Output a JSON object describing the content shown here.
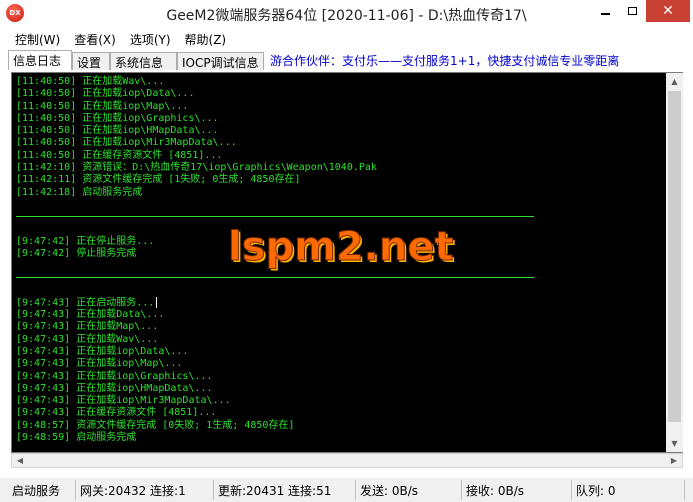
{
  "window": {
    "title": "GeeM2微端服务器64位 [2020-11-06] - D:\\热血传奇17\\",
    "icon_text": "DX"
  },
  "menu": [
    "控制(W)",
    "查看(X)",
    "选项(Y)",
    "帮助(Z)"
  ],
  "tabs": [
    "信息日志",
    "设置",
    "系统信息",
    "IOCP调试信息"
  ],
  "partner_text": "游合作伙伴：支付乐——支付服务1+1，快捷支付诚信专业零距离",
  "log_group1": [
    "[11:40:50] 正在加载Wav\\...",
    "[11:40:50] 正在加载iop\\Data\\...",
    "[11:40:50] 正在加载iop\\Map\\...",
    "[11:40:50] 正在加载iop\\Graphics\\...",
    "[11:40:50] 正在加载iop\\HMapData\\...",
    "[11:40:50] 正在加载iop\\Mir3MapData\\...",
    "[11:40:50] 正在缓存资源文件 [4851]...",
    "[11:42:10] 资源错误：D:\\热血传奇17\\iop\\Graphics\\Weapon\\1040.Pak",
    "[11:42:11] 资源文件缓存完成 [1失败; 0生成; 4850存在]",
    "[11:42:18] 启动服务完成"
  ],
  "log_group2": [
    "[9:47:42] 正在停止服务...",
    "[9:47:42] 停止服务完成"
  ],
  "log_group3": [
    "[9:47:43] 正在启动服务...",
    "[9:47:43] 正在加载Data\\...",
    "[9:47:43] 正在加载Map\\...",
    "[9:47:43] 正在加载Wav\\...",
    "[9:47:43] 正在加载iop\\Data\\...",
    "[9:47:43] 正在加载iop\\Map\\...",
    "[9:47:43] 正在加载iop\\Graphics\\...",
    "[9:47:43] 正在加载iop\\HMapData\\...",
    "[9:47:43] 正在加载iop\\Mir3MapData\\...",
    "[9:47:43] 正在缓存资源文件 [4851]...",
    "[9:48:57] 资源文件缓存完成 [0失败; 1生成; 4850存在]",
    "[9:48:59] 启动服务完成"
  ],
  "watermark": "lspm2.net",
  "status": {
    "service": "启动服务",
    "gateway": "网关:20432  连接:1",
    "update": "更新:20431  连接:51",
    "send": "发送: 0B/s",
    "recv": "接收: 0B/s",
    "queue": "队列: 0"
  },
  "colors": {
    "log_text": "#2ee02e",
    "log_bg": "#000000",
    "partner_text": "#0000cc",
    "close_button": "#c84031"
  }
}
